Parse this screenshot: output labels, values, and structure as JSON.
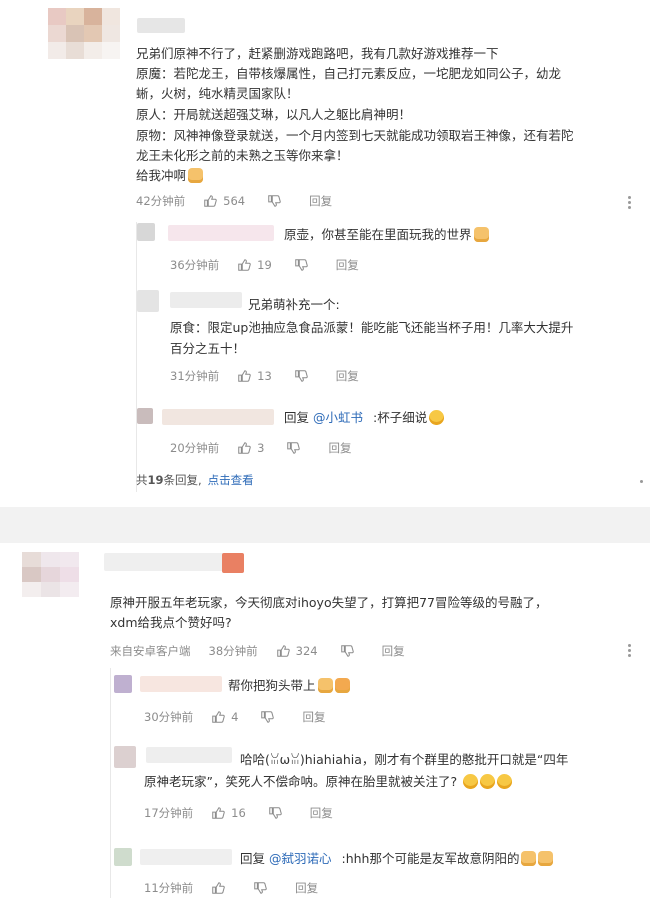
{
  "thread1": {
    "lines": [
      "兄弟们原神不行了，赶紧删游戏跑路吧，我有几款好游戏推荐一下",
      "原魔：若陀龙王，自带核爆属性，自己打元素反应，一坨肥龙如同公子，幼龙",
      "蜥，火树，纯水精灵国家队！",
      "原人：开局就送超强艾琳，以凡人之躯比肩神明！",
      "原物：风神神像登录就送，一个月内签到七天就能成功领取岩王神像，还有若陀",
      "龙王未化形之前的未熟之玉等你来拿！",
      "给我冲啊"
    ],
    "time": "42分钟前",
    "likes": "564",
    "reply_label": "回复",
    "replies": [
      {
        "text": "原壶，你甚至能在里面玩我的世界",
        "time": "36分钟前",
        "likes": "19",
        "reply_label": "回复"
      },
      {
        "prefix": "兄弟萌补充一个:",
        "text1": "原食：限定up池抽应急食品派蒙！能吃能飞还能当杯子用！几率大大提升",
        "text2": "百分之五十！",
        "time": "31分钟前",
        "likes": "13",
        "reply_label": "回复"
      },
      {
        "reply_word": "回复",
        "mention": "@小虹书",
        "text": ":杯子细说",
        "time": "20分钟前",
        "likes": "3",
        "reply_label": "回复"
      }
    ],
    "total_prefix": "共",
    "total_count": "19",
    "total_suffix": "条回复,",
    "view_link": "点击查看"
  },
  "thread2": {
    "lines": [
      "原神开服五年老玩家，今天彻底对ihoyo失望了，打算把77冒险等级的号融了，",
      "xdm给我点个赞好吗?"
    ],
    "source": "来自安卓客户端",
    "time": "38分钟前",
    "likes": "324",
    "reply_label": "回复",
    "replies": [
      {
        "text": "帮你把狗头带上",
        "time": "30分钟前",
        "likes": "4",
        "reply_label": "回复"
      },
      {
        "text1": "哈哈(ꈍωꈍ)hiahiahia，刚才有个群里的憨批开口就是“四年",
        "text2": "原神老玩家”，笑死人不偿命呐。原神在胎里就被关注了?",
        "time": "17分钟前",
        "likes": "16",
        "reply_label": "回复"
      },
      {
        "reply_word": "回复",
        "mention": "@弑羽诺心",
        "text": ":hhh那个可能是友军故意阴阳的",
        "time": "11分钟前",
        "likes": "",
        "reply_label": "回复"
      }
    ]
  },
  "colors": {
    "link": "#2e6bb8",
    "meta": "#8c8c8c",
    "text": "#333333",
    "divider": "#f2f2f2"
  }
}
